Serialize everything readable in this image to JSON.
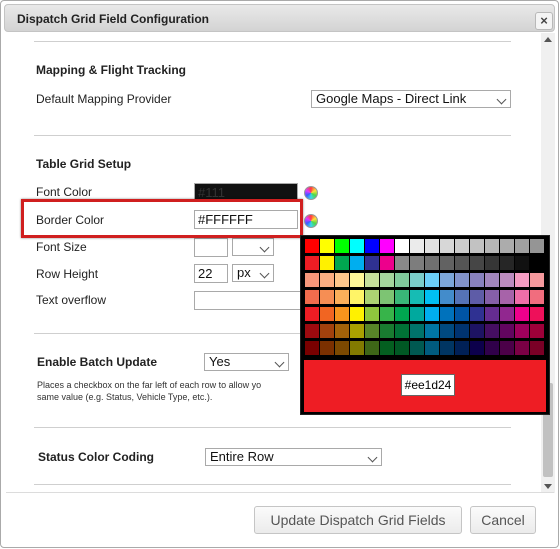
{
  "dialog": {
    "title": "Dispatch Grid Field Configuration",
    "close_glyph": "×"
  },
  "mapping": {
    "heading": "Mapping & Flight Tracking",
    "provider_label": "Default Mapping Provider",
    "provider_value": "Google Maps - Direct Link"
  },
  "table_grid": {
    "heading": "Table Grid Setup",
    "font_color_label": "Font Color",
    "font_color_value": "#111",
    "border_color_label": "Border Color",
    "border_color_value": "#FFFFFF",
    "font_size_label": "Font Size",
    "font_size_value": "",
    "font_size_unit": "",
    "row_height_label": "Row Height",
    "row_height_value": "22",
    "row_height_unit": "px",
    "text_overflow_label": "Text overflow",
    "text_overflow_value": ""
  },
  "batch": {
    "label": "Enable Batch Update",
    "value": "Yes",
    "help_line1": "Places a checkbox on the far left of each row to allow yo",
    "help_line2": "same value (e.g. Status, Vehicle Type, etc.)."
  },
  "status": {
    "label": "Status Color Coding",
    "value": "Entire Row"
  },
  "buttons": {
    "update": "Update Dispatch Grid Fields",
    "cancel": "Cancel"
  },
  "picker": {
    "preview_hex": "#ee1d24",
    "preview_color": "#ee1d24",
    "rows": [
      [
        "#ff0000",
        "#ffff00",
        "#00ff00",
        "#00ffff",
        "#0000ff",
        "#ff00ff",
        "#ffffff",
        "#ebebeb",
        "#e1e1e1",
        "#d7d7d7",
        "#cccccc",
        "#c2c2c2",
        "#b7b7b7",
        "#acacac",
        "#a0a0a0",
        "#959595"
      ],
      [
        "#ee1d24",
        "#fff100",
        "#00a650",
        "#00aeef",
        "#2f3192",
        "#ed008c",
        "#898989",
        "#7d7d7d",
        "#707070",
        "#626262",
        "#555555",
        "#464646",
        "#363636",
        "#262626",
        "#111111",
        "#000000"
      ],
      [
        "#f7977a",
        "#fbad82",
        "#fdc68c",
        "#fff799",
        "#c6df9c",
        "#a4d49d",
        "#81ca9d",
        "#7bcdc9",
        "#6ccff7",
        "#7ca6d8",
        "#8293ca",
        "#8881be",
        "#a286bd",
        "#bc8cbf",
        "#f49bc1",
        "#f5999d"
      ],
      [
        "#f16c4d",
        "#f68e54",
        "#fbaf5a",
        "#fff467",
        "#acd372",
        "#7dc473",
        "#39b778",
        "#16bcb4",
        "#00bff3",
        "#438ccb",
        "#5573b7",
        "#5e5ca7",
        "#855fa8",
        "#a763a9",
        "#ef6ea8",
        "#f16d7e"
      ],
      [
        "#ee1d24",
        "#f16522",
        "#f7941d",
        "#fff100",
        "#8fc63d",
        "#37b44a",
        "#00a650",
        "#00a99e",
        "#00aeef",
        "#0072bc",
        "#0054a5",
        "#2f3192",
        "#652c91",
        "#91278f",
        "#ed008c",
        "#ee105a"
      ],
      [
        "#9d0a0f",
        "#a1410d",
        "#a36209",
        "#aba000",
        "#588528",
        "#197b30",
        "#007236",
        "#00736a",
        "#0076a4",
        "#004a80",
        "#003370",
        "#1d1363",
        "#450e61",
        "#62055f",
        "#9e005c",
        "#9d0039"
      ],
      [
        "#790000",
        "#7b3000",
        "#7c4900",
        "#827a00",
        "#3e6617",
        "#045f20",
        "#005824",
        "#005951",
        "#005b7e",
        "#003562",
        "#002056",
        "#0c004b",
        "#30004a",
        "#4b0048",
        "#7a0045",
        "#7a0026"
      ]
    ]
  }
}
